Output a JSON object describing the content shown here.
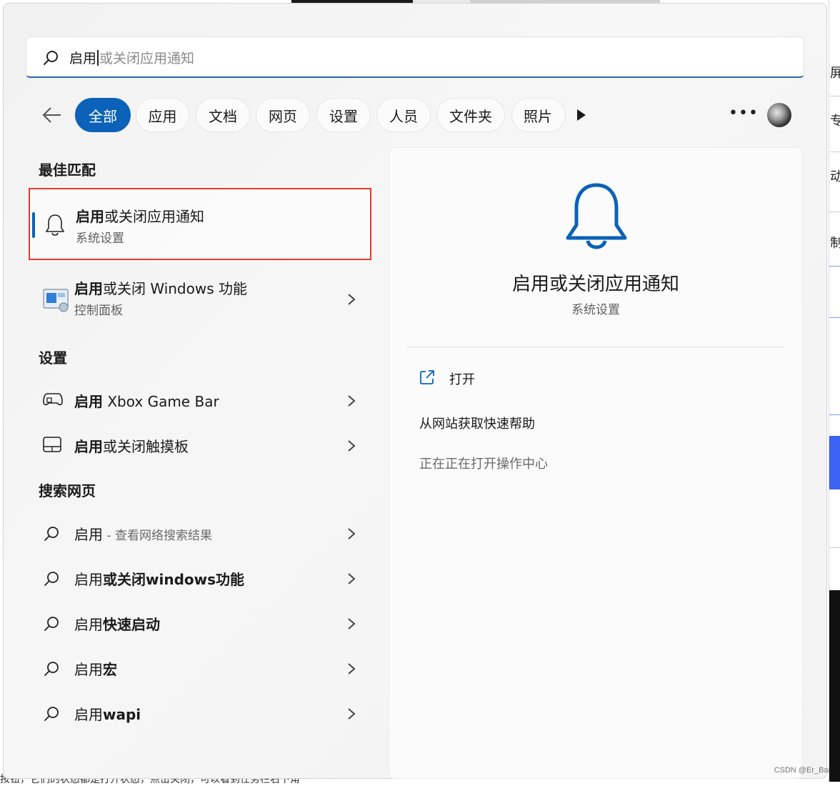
{
  "search": {
    "typed": "启用",
    "suggestion": "或关闭应用通知"
  },
  "filters": [
    "全部",
    "应用",
    "文档",
    "网页",
    "设置",
    "人员",
    "文件夹",
    "照片"
  ],
  "sections": {
    "best_match": "最佳匹配",
    "settings": "设置",
    "web": "搜索网页"
  },
  "best_match": {
    "title_bold": "启用",
    "title_rest": "或关闭应用通知",
    "subtitle": "系统设置",
    "icon": "bell-icon"
  },
  "app_result": {
    "title_bold": "启用",
    "title_rest": "或关闭 Windows 功能",
    "subtitle": "控制面板",
    "icon": "control-panel-icon"
  },
  "settings_results": [
    {
      "bold": "启用",
      "rest": " Xbox Game Bar",
      "icon": "gamepad-icon"
    },
    {
      "bold": "启用",
      "rest": "或关闭触摸板",
      "icon": "touchpad-icon"
    }
  ],
  "web_results": [
    {
      "normal": "启用",
      "bold": "",
      "muted": " - 查看网络搜索结果"
    },
    {
      "normal": "启用",
      "bold": "或关闭windows功能",
      "muted": ""
    },
    {
      "normal": "启用",
      "bold": "快速启动",
      "muted": ""
    },
    {
      "normal": "启用",
      "bold": "宏",
      "muted": ""
    },
    {
      "normal": "启用",
      "bold": "wapi",
      "muted": ""
    }
  ],
  "detail": {
    "title": "启用或关闭应用通知",
    "subtitle": "系统设置",
    "open_label": "打开",
    "help_label": "从网站获取快速帮助",
    "status_text": "正在正在打开操作中心"
  },
  "background": {
    "right_fragments": [
      "屏",
      "专",
      "动",
      "制"
    ],
    "bottom_text": "按钮，它们的状态都是打开状态，点击关闭，可以看到任务栏右下角",
    "watermark": "CSDN @Er_Bai"
  },
  "colors": {
    "accent": "#0b62b8",
    "highlight_border": "#e33b2a"
  }
}
